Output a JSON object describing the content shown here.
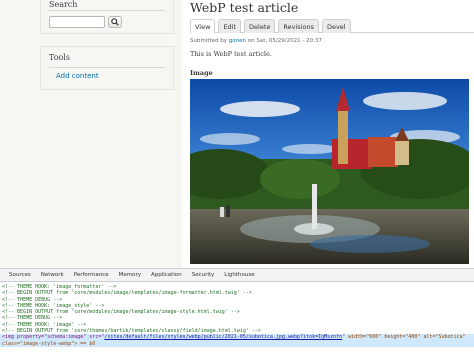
{
  "sidebar": {
    "search": {
      "title": "Search",
      "input_value": ""
    },
    "tools": {
      "title": "Tools",
      "link": "Add content"
    }
  },
  "main": {
    "title": "WebP test article",
    "tabs": [
      {
        "label": "View",
        "active": true
      },
      {
        "label": "Edit"
      },
      {
        "label": "Delete"
      },
      {
        "label": "Revisions"
      },
      {
        "label": "Devel"
      }
    ],
    "submitted": {
      "prefix": "Submitted by ",
      "author": "gonen",
      "suffix": " on Sat, 05/29/2021 - 20:37"
    },
    "body": "This is WebP test article.",
    "image_label": "Image"
  },
  "devtools": {
    "tabs": [
      "Sources",
      "Network",
      "Performance",
      "Memory",
      "Application",
      "Security",
      "Lighthouse"
    ],
    "lines": [
      "<!-- THEME HOOK: 'image_formatter' -->",
      "<!-- BEGIN OUTPUT from 'core/modules/image/templates/image-formatter.html.twig' -->",
      "<!-- THEME DEBUG -->",
      "<!-- THEME HOOK: 'image_style' -->",
      "<!-- BEGIN OUTPUT from 'core/modules/image/templates/image-style.html.twig' -->",
      "<!-- THEME DEBUG -->",
      "<!-- THEME HOOK: 'image' -->",
      "<!-- BEGIN OUTPUT from 'core/themes/bartik/templates/classy/field/image.html.twig' -->"
    ],
    "selected": {
      "prefix": "<img property=\"schema:image\" src=\"",
      "src": "/sites/default/files/styles/webp/public/2021-05/subotica.jpg.webp?itok=IqMsznfn",
      "middle": "\" width=\"600\" height=\"400\" alt=\"Subotica\"",
      "line2": "class=\"image-style-webp\"> == $0"
    }
  }
}
